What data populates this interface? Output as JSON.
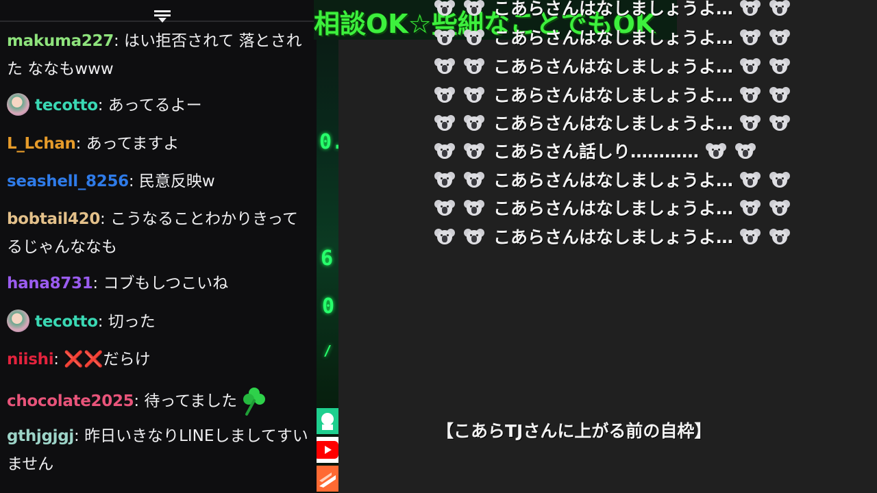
{
  "banner": {
    "text": "相談OK☆些細なことでもOK"
  },
  "chat": {
    "messages": [
      {
        "user": "makuma227",
        "color": "#8ee27c",
        "text": "はい拒否されて 落とされた ななもwww"
      },
      {
        "user": "tecotto",
        "color": "#3ad8b4",
        "text": "あってるよー",
        "avatar": true
      },
      {
        "user": "L_Lchan",
        "color": "#e69b2a",
        "text": "あってますよ"
      },
      {
        "user": "seashell_8256",
        "color": "#2f7be8",
        "text": "民意反映w"
      },
      {
        "user": "bobtail420",
        "color": "#e3c08a",
        "text": "こうなることわかりきってるじゃんななも"
      },
      {
        "user": "hana8731",
        "color": "#9a5cf0",
        "text": "コブもしつこいね"
      },
      {
        "user": "tecotto",
        "color": "#3ad8b4",
        "text": "切った",
        "avatar": true
      },
      {
        "user": "niishi",
        "color": "#e3233d",
        "text": "だらけ",
        "marks": "❌❌"
      },
      {
        "user": "chocolate2025",
        "color": "#e8547a",
        "text": "待ってました",
        "emote": "clover"
      },
      {
        "user": "gthjgjgj",
        "color": "#9dd4c8",
        "text": "昨日いきなりLINEしましてすいません"
      }
    ]
  },
  "overlay": {
    "lines": [
      "こあらさんはなしましょうよ…",
      "こあらさんはなしましょうよ…",
      "こあらさんはなしましょうよ…",
      "こあらさんはなしましょうよ…",
      "こあらさんはなしましょうよ…",
      "こあらさん話しり…………",
      "こあらさんはなしましょうよ…",
      "こあらさんはなしましょうよ…",
      "こあらさんはなしましょうよ…"
    ],
    "caption": "【こあらTJさんに上がる前の自枠】"
  }
}
